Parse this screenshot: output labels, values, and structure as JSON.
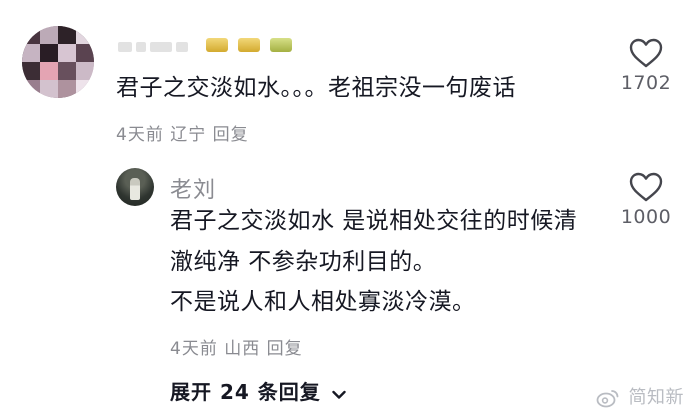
{
  "comment": {
    "text": "君子之交淡如水。。。老祖宗没一句废话",
    "meta": "4天前 辽宁 回复",
    "like_count": "1702",
    "icons": {
      "avatar": "blurred-avatar",
      "like": "heart-outline-icon"
    }
  },
  "reply": {
    "author": "老刘",
    "lines": [
      "君子之交淡如水 是说相处交往的时候清",
      "澈纯净 不参杂功利目的。",
      "不是说人和人相处寡淡冷漠。"
    ],
    "meta": "4天前 山西 回复",
    "like_count": "1000"
  },
  "expand": {
    "label": "展开 24 条回复"
  },
  "watermark": {
    "text": "简知新"
  },
  "colors": {
    "text": "#161823",
    "meta": "#8a8b91",
    "count": "#5d5e66"
  }
}
